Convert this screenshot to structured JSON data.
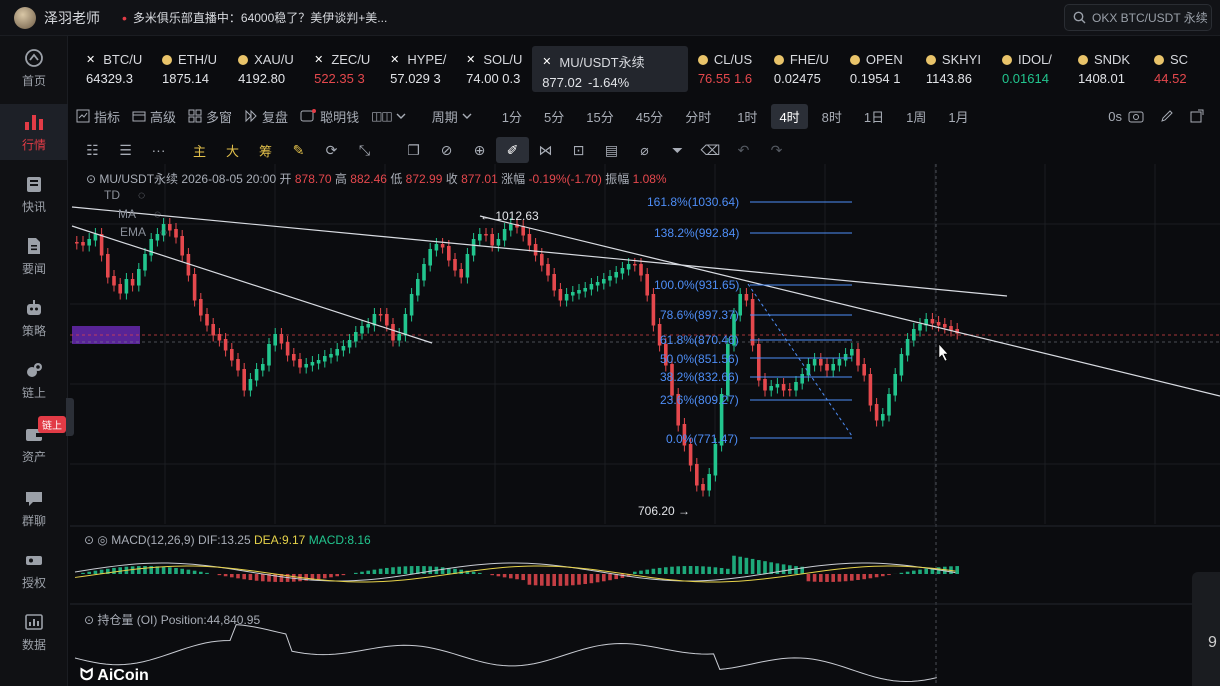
{
  "topbar": {
    "user_name": "泽羽老师",
    "news": "多米俱乐部直播中：64000稳了？美伊谈判+美...",
    "search_placeholder": "OKX BTC/USDT 永续"
  },
  "sidenav": {
    "items": [
      {
        "label": "首页",
        "icon": "home-icon"
      },
      {
        "label": "行情",
        "icon": "chart-icon",
        "active": true
      },
      {
        "label": "快讯",
        "icon": "news-icon"
      },
      {
        "label": "要闻",
        "icon": "document-icon"
      },
      {
        "label": "策略",
        "icon": "robot-icon"
      },
      {
        "label": "链上",
        "icon": "chain-icon"
      },
      {
        "label": "资产",
        "icon": "wallet-icon",
        "badge": "链上"
      },
      {
        "label": "群聊",
        "icon": "chat-icon"
      },
      {
        "label": "授权",
        "icon": "key-icon"
      },
      {
        "label": "数据",
        "icon": "data-icon"
      }
    ]
  },
  "tickers": [
    {
      "symbol": "BTC/U",
      "price": "64329.3",
      "color": "neutral",
      "icon": "x-icon"
    },
    {
      "symbol": "ETH/U",
      "price": "1875.14",
      "color": "neutral",
      "icon": "coin-icon"
    },
    {
      "symbol": "XAU/U",
      "price": "4192.80",
      "color": "neutral",
      "icon": "coin-icon"
    },
    {
      "symbol": "ZEC/U",
      "price": "522.35 3",
      "color": "down",
      "icon": "x-icon"
    },
    {
      "symbol": "HYPE/",
      "price": "57.029 3",
      "color": "neutral",
      "icon": "x-icon"
    },
    {
      "symbol": "SOL/U",
      "price": "74.00 0.3",
      "color": "neutral",
      "icon": "x-icon"
    },
    {
      "symbol": "MU/USDT永续",
      "price": "877.02",
      "change": "-1.64%",
      "color": "neutral",
      "icon": "x-icon",
      "active": true
    },
    {
      "symbol": "CL/US",
      "price": "76.55 1.6",
      "color": "down",
      "icon": "coin-icon"
    },
    {
      "symbol": "FHE/U",
      "price": "0.02475",
      "color": "neutral",
      "icon": "coin-icon"
    },
    {
      "symbol": "OPEN",
      "price": "0.1954 1",
      "color": "neutral",
      "icon": "coin-icon"
    },
    {
      "symbol": "SKHYI",
      "price": "1143.86",
      "color": "neutral",
      "icon": "coin-icon"
    },
    {
      "symbol": "IDOL/",
      "price": "0.01614",
      "color": "up",
      "icon": "coin-icon"
    },
    {
      "symbol": "SNDK",
      "price": "1408.01",
      "color": "neutral",
      "icon": "coin-icon"
    },
    {
      "symbol": "SC",
      "price": "44.52",
      "color": "down",
      "icon": "coin-icon"
    }
  ],
  "toolbar1": {
    "items": [
      "指标",
      "高级",
      "多窗",
      "复盘",
      "聪明钱"
    ],
    "period_label": "周期",
    "timeframes": [
      "1分",
      "5分",
      "15分",
      "45分",
      "分时",
      "1时",
      "4时",
      "8时",
      "1日",
      "1周",
      "1月"
    ],
    "active_timeframe": "4时",
    "countdown": "0s"
  },
  "toolbar2": {
    "main_labels": [
      "主",
      "大",
      "筹"
    ]
  },
  "legend": {
    "symbol": "MU/USDT永续",
    "datetime": "2026-08-05 20:00",
    "open_label": "开",
    "open": "878.70",
    "high_label": "高",
    "high": "882.46",
    "low_label": "低",
    "low": "872.99",
    "close_label": "收",
    "close": "877.01",
    "change_label": "涨幅",
    "change": "-0.19%(-1.70)",
    "amp_label": "振幅",
    "amp": "1.08%"
  },
  "indicators": [
    "TD",
    "MA",
    "EMA"
  ],
  "fib_levels": [
    {
      "label": "161.8%(1030.64)"
    },
    {
      "label": "138.2%(992.84)"
    },
    {
      "label": "100.0%(931.65)"
    },
    {
      "label": "78.6%(897.37)"
    },
    {
      "label": "61.8%(870.46)"
    },
    {
      "label": "50.0%(851.56)"
    },
    {
      "label": "38.2%(832.66)"
    },
    {
      "label": "23.6%(809.27)"
    },
    {
      "label": "0.0%(771.47)"
    }
  ],
  "price_notes": {
    "high": "← 1012.63",
    "low": "706.20 →"
  },
  "macd": {
    "label": "MACD(12,26,9)",
    "dif_label": "DIF:13.25",
    "dea_label": "DEA:9.17",
    "macd_label": "MACD:8.16"
  },
  "oi": {
    "label": "持仓量 (OI)",
    "value": "Position:44,840.95"
  },
  "footer": {
    "logo": "AiCoin",
    "side_text": "9"
  },
  "colors": {
    "up": "#22c58e",
    "down": "#e5484d",
    "accent": "#e23b46",
    "fib": "#4e8ef7",
    "dea": "#e6d24a"
  }
}
